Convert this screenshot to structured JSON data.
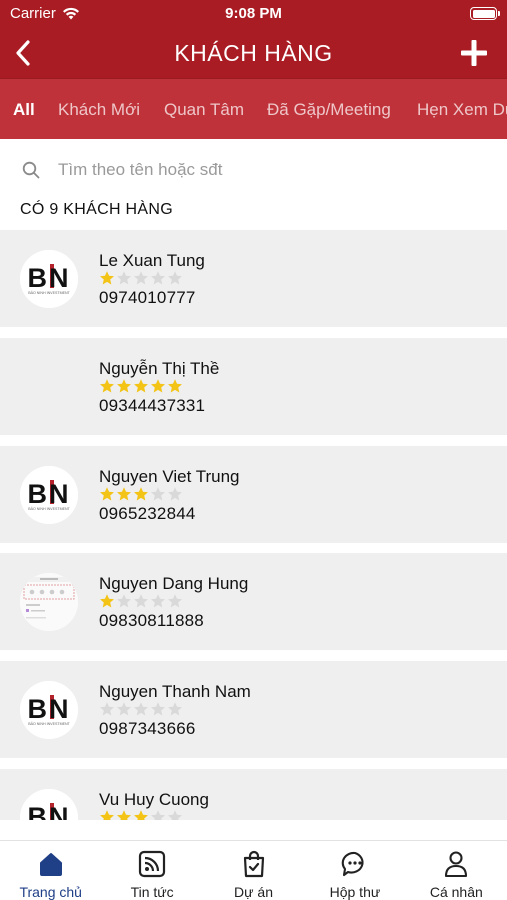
{
  "status_bar": {
    "carrier": "Carrier",
    "time": "9:08 PM"
  },
  "header": {
    "title": "KHÁCH HÀNG"
  },
  "tabs": [
    {
      "label": "All",
      "active": true
    },
    {
      "label": "Khách Mới",
      "active": false
    },
    {
      "label": "Quan Tâm",
      "active": false
    },
    {
      "label": "Đã Gặp/Meeting",
      "active": false
    },
    {
      "label": "Hẹn Xem Dự",
      "active": false
    }
  ],
  "search": {
    "placeholder": "Tìm theo tên hoặc sđt"
  },
  "summary": {
    "count_text": "CÓ 9 KHÁCH HÀNG"
  },
  "customers": [
    {
      "name": "Le Xuan Tung",
      "rating": 1,
      "phone": "0974010777",
      "avatar": "bn-logo"
    },
    {
      "name": "Nguyễn Thị Thề",
      "rating": 5,
      "phone": "09344437331",
      "avatar": "none"
    },
    {
      "name": "Nguyen Viet Trung",
      "rating": 3,
      "phone": "0965232844",
      "avatar": "bn-logo"
    },
    {
      "name": "Nguyen Dang Hung",
      "rating": 1,
      "phone": "09830811888",
      "avatar": "screenshot"
    },
    {
      "name": "Nguyen Thanh Nam",
      "rating": 0,
      "phone": "0987343666",
      "avatar": "bn-logo"
    },
    {
      "name": "Vu Huy Cuong",
      "rating": 3,
      "phone": "",
      "avatar": "bn-logo"
    }
  ],
  "avatar_logo": {
    "mark": "BN",
    "caption": "BẢO NINH INVESTMENT"
  },
  "bottom_nav": [
    {
      "label": "Trang chủ",
      "icon": "home-icon",
      "active": true
    },
    {
      "label": "Tin tức",
      "icon": "news-icon",
      "active": false
    },
    {
      "label": "Dự án",
      "icon": "shopping-bag-icon",
      "active": false
    },
    {
      "label": "Hộp thư",
      "icon": "chat-icon",
      "active": false
    },
    {
      "label": "Cá nhân",
      "icon": "user-icon",
      "active": false
    }
  ],
  "colors": {
    "header": "#a91c24",
    "tabs_bg": "#c0323a",
    "star_filled": "#f3c316",
    "star_empty": "#d9d9d9",
    "nav_active": "#1f3f87"
  }
}
